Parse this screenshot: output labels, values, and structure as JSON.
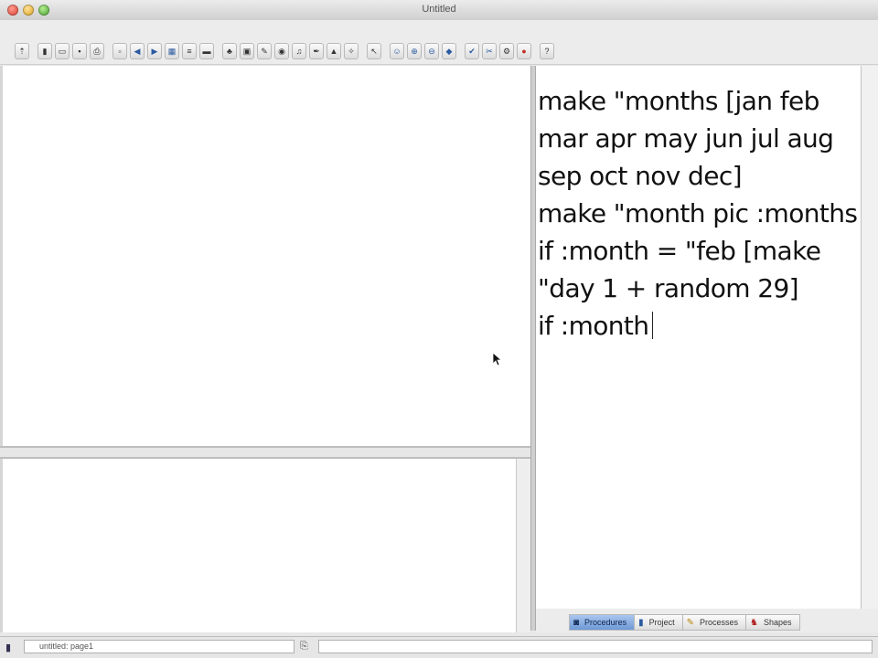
{
  "window": {
    "title": "Untitled"
  },
  "toolbar": {
    "tools": [
      {
        "icon": "arrow-icon",
        "glyph": "⇡"
      },
      {
        "icon": "device-icon",
        "glyph": "▮"
      },
      {
        "icon": "folder-icon",
        "glyph": "▭"
      },
      {
        "icon": "save-icon",
        "glyph": "▪"
      },
      {
        "icon": "print-icon",
        "glyph": "⎙"
      },
      {
        "icon": "page-icon",
        "glyph": "▫"
      },
      {
        "icon": "prev-page-icon",
        "glyph": "◀"
      },
      {
        "icon": "next-page-icon",
        "glyph": "▶"
      },
      {
        "icon": "film-icon",
        "glyph": "▦"
      },
      {
        "icon": "list-icon",
        "glyph": "≡"
      },
      {
        "icon": "textbox-icon",
        "glyph": "▬"
      },
      {
        "icon": "turtle-icon",
        "glyph": "♣"
      },
      {
        "icon": "image-icon",
        "glyph": "▣"
      },
      {
        "icon": "stamp-icon",
        "glyph": "✎"
      },
      {
        "icon": "eye-icon",
        "glyph": "◉"
      },
      {
        "icon": "music-icon",
        "glyph": "♫"
      },
      {
        "icon": "pen-icon",
        "glyph": "✒"
      },
      {
        "icon": "paint-icon",
        "glyph": "▲"
      },
      {
        "icon": "magic-wand-icon",
        "glyph": "✧"
      },
      {
        "icon": "pointer-icon",
        "glyph": "↖"
      },
      {
        "icon": "person-icon",
        "glyph": "☺"
      },
      {
        "icon": "zoom-in-icon",
        "glyph": "⊕"
      },
      {
        "icon": "zoom-out-icon",
        "glyph": "⊖"
      },
      {
        "icon": "target-icon",
        "glyph": "◆"
      },
      {
        "icon": "check-icon",
        "glyph": "✔"
      },
      {
        "icon": "scissors-icon",
        "glyph": "✂"
      },
      {
        "icon": "gear-icon",
        "glyph": "⚙"
      },
      {
        "icon": "stop-icon",
        "glyph": "●"
      },
      {
        "icon": "help-icon",
        "glyph": "?"
      }
    ]
  },
  "procedures": {
    "lines": [
      "make \"months [jan feb",
      "mar apr may jun jul aug",
      "sep oct nov dec]",
      "",
      "make \"month pic :months",
      "if :month = \"feb [make",
      "\"day 1 + random 29]",
      "if :month"
    ]
  },
  "tabs": [
    {
      "label": "Procedures",
      "icon": "procedures-icon",
      "glyph": "◙",
      "active": true
    },
    {
      "label": "Project",
      "icon": "project-icon",
      "glyph": "▮",
      "active": false
    },
    {
      "label": "Processes",
      "icon": "processes-icon",
      "glyph": "✎",
      "active": false
    },
    {
      "label": "Shapes",
      "icon": "shapes-icon",
      "glyph": "♞",
      "active": false
    }
  ],
  "status": {
    "page_label": "untitled: page1"
  },
  "colors": {
    "active_tab": "#6e99d6",
    "stop": "#c0302a"
  }
}
